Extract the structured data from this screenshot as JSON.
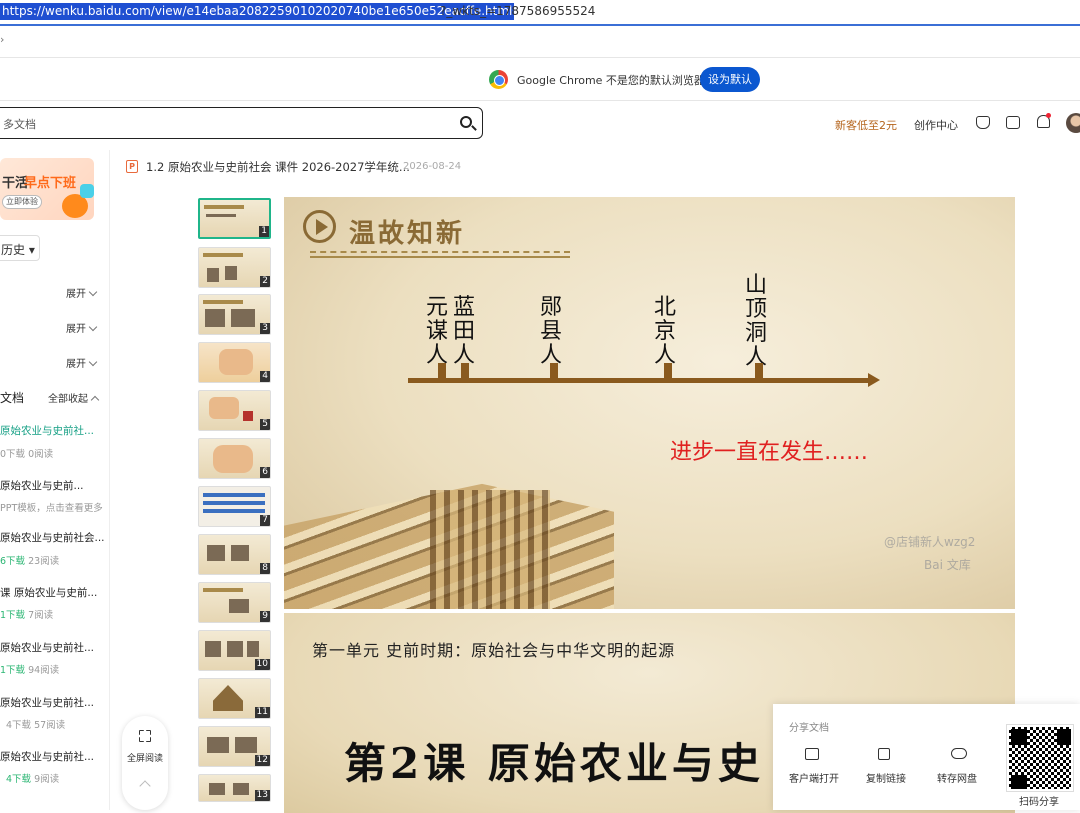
{
  "browser": {
    "url_selected": "https://wenku.baidu.com/view/e14ebaa20822590102020740be1e650e52eacffe.html",
    "url_rest": "?_wkts_=1787586955524",
    "caret": "›"
  },
  "notice": {
    "text": "Google Chrome 不是您的默认浏览器",
    "button": "设为默认"
  },
  "header": {
    "search_placeholder": "多文档",
    "promo": "新客低至2元",
    "creator": "创作中心"
  },
  "sidebar": {
    "ad": {
      "text1": "干活",
      "text2": "早点下班",
      "button": "立即体验"
    },
    "subject": "历史 ▾",
    "expand_label": "展开",
    "docs_title": "文档",
    "collapse_label": "全部收起",
    "docs": [
      {
        "title": "原始农业与史前社...",
        "meta_green": "",
        "meta": "0下载  0阅读",
        "active": true
      },
      {
        "title": "原始农业与史前...",
        "meta_green": "",
        "meta": "PPT模板，点击查看更多",
        "active": false
      },
      {
        "title": "原始农业与史前社会...",
        "meta_green": "6下载",
        "meta": "  23阅读",
        "active": false
      },
      {
        "title": "课 原始农业与史前...",
        "meta_green": "1下载",
        "meta": "  7阅读",
        "active": false
      },
      {
        "title": "原始农业与史前社...",
        "meta_green": "1下载",
        "meta": "  94阅读",
        "active": false
      },
      {
        "title": "原始农业与史前社...",
        "meta_green": "",
        "meta": "4下载  57阅读",
        "active": false
      },
      {
        "title": "原始农业与史前社...",
        "meta_green": "4下载",
        "meta": "  9阅读",
        "active": false
      }
    ]
  },
  "document": {
    "icon": "P",
    "title": "1.2 原始农业与史前社会 课件 2026-2027学年统...",
    "date": "2026-08-24"
  },
  "thumbnails": [
    "1",
    "2",
    "3",
    "4",
    "5",
    "6",
    "7",
    "8",
    "9",
    "10",
    "11",
    "12",
    "13"
  ],
  "slide1": {
    "title": "温故知新",
    "labels": [
      "元谋人",
      "蓝田人",
      "郧县人",
      "北京人",
      "山顶洞人"
    ],
    "progress_text": "进步一直在发生……",
    "watermark1": "@店铺新人wzg2",
    "watermark2": "Bai 文库"
  },
  "slide2": {
    "unit": "第一单元  史前时期：原始社会与中华文明的起源",
    "lesson": "第2课  原始农业与史"
  },
  "fullscreen": {
    "label": "全屏阅读"
  },
  "share": {
    "title": "分享文档",
    "actions": [
      "客户端打开",
      "复制链接",
      "转存网盘"
    ],
    "qr_label": "扫码分享"
  },
  "icons": {
    "search": "search-icon",
    "chrome": "chrome-logo-icon",
    "bell": "bell-icon",
    "fullscreen": "fullscreen-icon",
    "play": "play-circle-icon",
    "qr": "qr-code-icon"
  },
  "colors": {
    "accent_blue": "#0b57d0",
    "promo": "#b5651d",
    "active_doc": "#16a085",
    "slide_red": "#e02020",
    "timeline_brown": "#8a5a1e"
  }
}
